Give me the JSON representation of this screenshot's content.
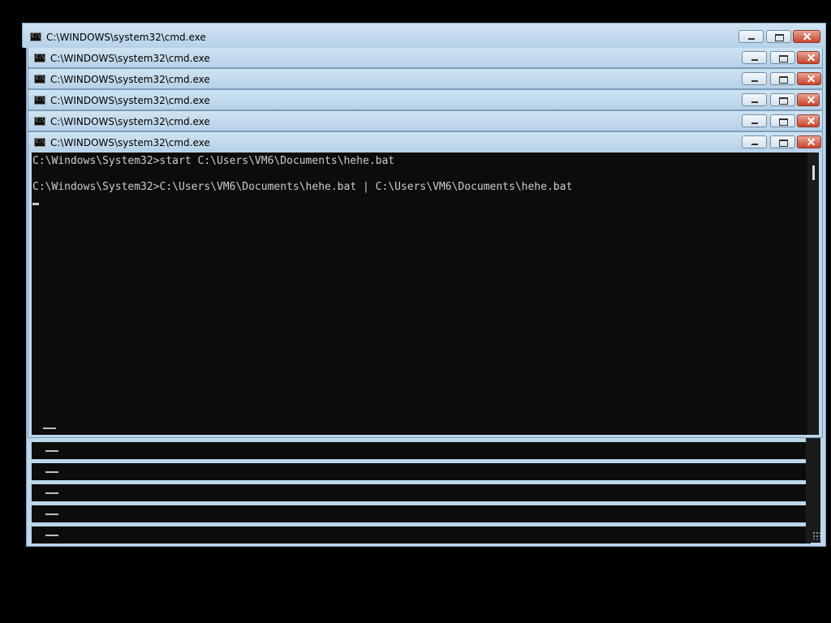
{
  "windows": [
    {
      "title": "C:\\WINDOWS\\system32\\cmd.exe"
    },
    {
      "title": "C:\\WINDOWS\\system32\\cmd.exe"
    },
    {
      "title": "C:\\WINDOWS\\system32\\cmd.exe"
    },
    {
      "title": "C:\\WINDOWS\\system32\\cmd.exe"
    },
    {
      "title": "C:\\WINDOWS\\system32\\cmd.exe"
    },
    {
      "title": "C:\\WINDOWS\\system32\\cmd.exe"
    }
  ],
  "icons": {
    "app": "cmd-icon",
    "app_glyph": "C:\\_",
    "minimize": "minimize-icon",
    "maximize": "maximize-icon",
    "close": "close-icon",
    "resize": "resize-grip-icon"
  },
  "console": {
    "lines": [
      "C:\\Windows\\System32>start C:\\Users\\VM6\\Documents\\hehe.bat",
      "C:\\Windows\\System32>C:\\Users\\VM6\\Documents\\hehe.bat | C:\\Users\\VM6\\Documents\\hehe.bat"
    ]
  },
  "colors": {
    "console_bg": "#0c0c0c",
    "console_text": "#cccccc",
    "frame": "#bcd6ea",
    "close_button": "#c9432c"
  }
}
